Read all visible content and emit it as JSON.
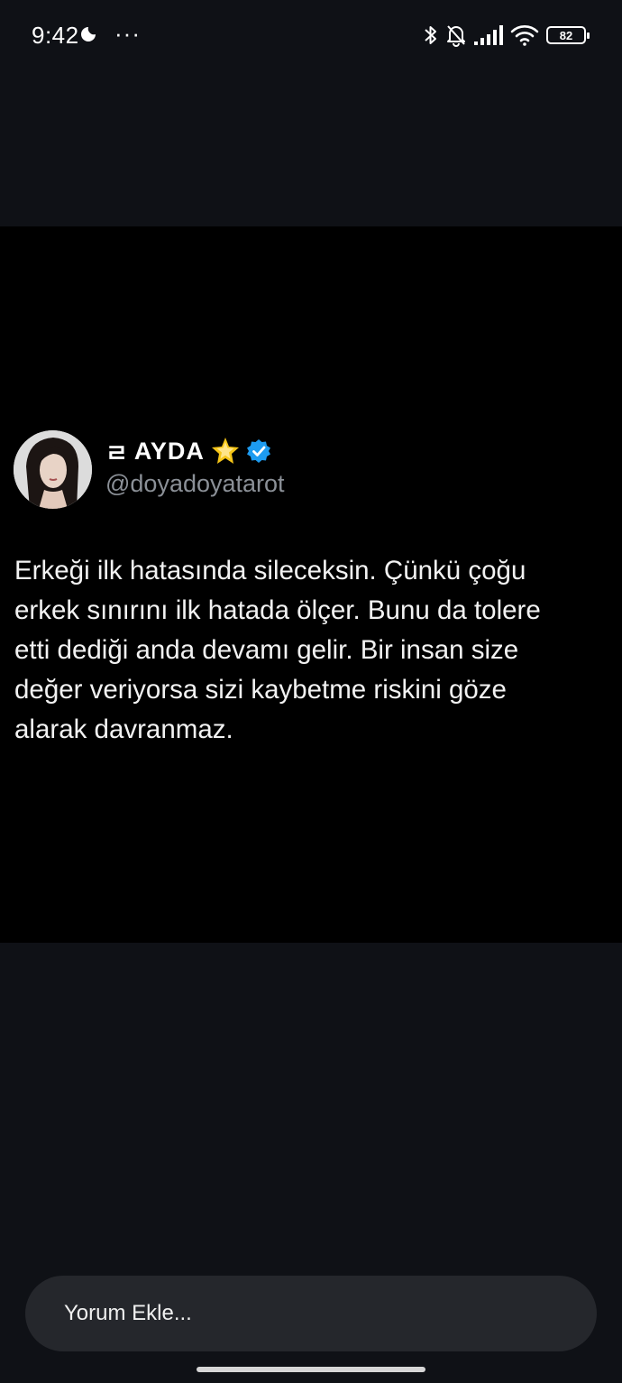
{
  "status_bar": {
    "time": "9:42",
    "dots": "···",
    "battery": "82"
  },
  "post": {
    "display_name_prefix": "ㄹ",
    "display_name": "AYDA",
    "handle": "@doyadoyatarot",
    "text": "Erkeği ilk hatasında sileceksin. Çünkü çoğu\nerkek sınırını ilk hatada ölçer. Bunu da tolere\netti dediği anda devamı gelir. Bir insan size\ndeğer veriyorsa sizi kaybetme riskini göze\nalarak davranmaz."
  },
  "comment_bar": {
    "placeholder": "Yorum Ekle..."
  },
  "colors": {
    "background": "#0f1116",
    "post_background": "#000000",
    "handle": "#8b9097",
    "verified": "#1d9bf0",
    "comment_bar": "#25272c"
  }
}
